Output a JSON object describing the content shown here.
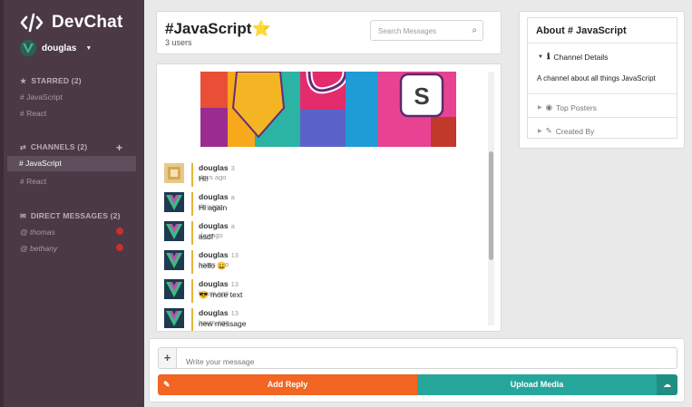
{
  "app": {
    "name": "DevChat"
  },
  "user": {
    "name": "douglas"
  },
  "sidebar": {
    "starred_header": "STARRED (2)",
    "starred": [
      "# JavaScript",
      "# React"
    ],
    "channels_header": "CHANNELS (2)",
    "channels": [
      "# JavaScript",
      "# React"
    ],
    "dm_header": "DIRECT MESSAGES (2)",
    "direct_messages": [
      "@ thomas",
      "@ bethany"
    ]
  },
  "channel": {
    "title": "#JavaScript",
    "star": "⭐",
    "users": "3 users",
    "search_placeholder": "Search Messages"
  },
  "messages": [
    {
      "user": "douglas",
      "time": "3 days ago",
      "text": "Hi!"
    },
    {
      "user": "douglas",
      "time": "a day ago",
      "text": "Hi again"
    },
    {
      "user": "douglas",
      "time": "a day ago",
      "text": "asdf"
    },
    {
      "user": "douglas",
      "time": "13 hours ago",
      "text": "hello 😀"
    },
    {
      "user": "douglas",
      "time": "13 hours ago",
      "text": "😎 more text"
    },
    {
      "user": "douglas",
      "time": "13 hours ago",
      "text": "new message"
    }
  ],
  "composer": {
    "placeholder": "Write your message",
    "add_reply": "Add Reply",
    "upload_media": "Upload Media"
  },
  "about": {
    "title": "About # JavaScript",
    "details_label": "Channel Details",
    "description": "A channel about all things JavaScript",
    "top_posters": "Top Posters",
    "created_by": "Created By"
  },
  "colors": {
    "sidebar": "#4b3946",
    "reply": "#f26522",
    "upload": "#26a69a",
    "unread_dot": "#c9302c"
  }
}
